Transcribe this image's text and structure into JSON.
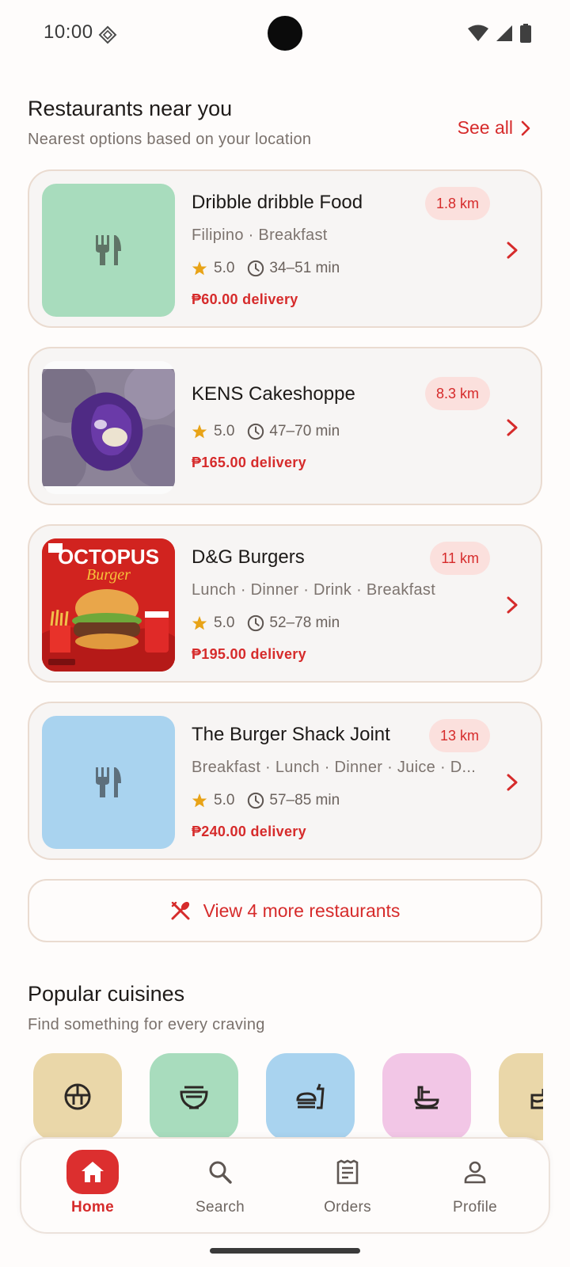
{
  "status_bar": {
    "time": "10:00"
  },
  "nearby": {
    "title": "Restaurants near you",
    "subtitle": "Nearest options based on your location",
    "see_all": "See all",
    "restaurants": [
      {
        "name": "Dribble dribble Food",
        "distance": "1.8 km",
        "tags": "Filipino · Breakfast",
        "rating": "5.0",
        "time": "34–51 min",
        "fee": "₱60.00 delivery",
        "thumb": "placeholder",
        "thumb_color": "#a8dcbd"
      },
      {
        "name": "KENS Cakeshoppe",
        "distance": "8.3 km",
        "tags": "",
        "rating": "5.0",
        "time": "47–70 min",
        "fee": "₱165.00 delivery",
        "thumb": "photo-ube-pandesal"
      },
      {
        "name": "D&G Burgers",
        "distance": "11 km",
        "tags": "Lunch · Dinner · Drink · Breakfast",
        "rating": "5.0",
        "time": "52–78 min",
        "fee": "₱195.00 delivery",
        "thumb": "photo-octopus-burger",
        "thumb_title": "OCTOPUS",
        "thumb_subtitle": "Burger"
      },
      {
        "name": "The Burger Shack Joint",
        "distance": "13 km",
        "tags": "Breakfast · Lunch · Dinner · Juice · D...",
        "rating": "5.0",
        "time": "57–85 min",
        "fee": "₱240.00 delivery",
        "thumb": "placeholder",
        "thumb_color": "#a9d3ef"
      }
    ],
    "view_more": "View 4 more restaurants"
  },
  "cuisines": {
    "title": "Popular cuisines",
    "subtitle": "Find something for every craving",
    "items": [
      {
        "icon": "rice-bowl-icon",
        "color": "#ead7a9"
      },
      {
        "icon": "noodle-bowl-icon",
        "color": "#a8dcbd"
      },
      {
        "icon": "fast-food-icon",
        "color": "#a9d3ef"
      },
      {
        "icon": "ramen-icon",
        "color": "#f2c6e6"
      },
      {
        "icon": "cake-icon",
        "color": "#ead7a9"
      }
    ]
  },
  "nav": {
    "items": [
      {
        "label": "Home",
        "icon": "home-icon",
        "active": true
      },
      {
        "label": "Search",
        "icon": "search-icon"
      },
      {
        "label": "Orders",
        "icon": "receipt-icon"
      },
      {
        "label": "Profile",
        "icon": "person-icon"
      }
    ]
  },
  "colors": {
    "accent": "#d62b2b",
    "star": "#e8a317"
  }
}
